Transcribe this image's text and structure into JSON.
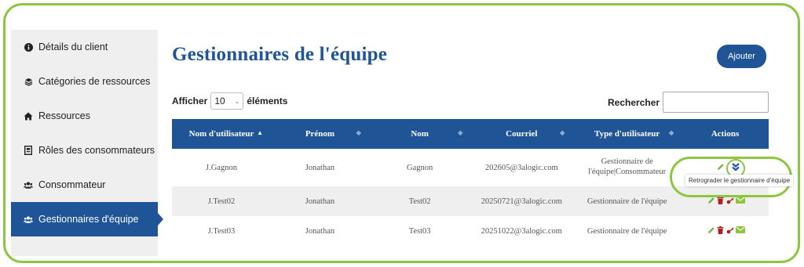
{
  "sidebar": {
    "items": [
      {
        "label": "Détails du client",
        "icon": "info-circle-icon"
      },
      {
        "label": "Catégories de ressources",
        "icon": "layers-icon"
      },
      {
        "label": "Ressources",
        "icon": "home-icon"
      },
      {
        "label": "Rôles des consommateurs",
        "icon": "id-card-icon"
      },
      {
        "label": "Consommateur",
        "icon": "users-icon"
      },
      {
        "label": "Gestionnaires d'équipe",
        "icon": "users-icon",
        "active": true
      }
    ]
  },
  "page": {
    "title": "Gestionnaires de l'équipe",
    "add_label": "Ajouter"
  },
  "controls": {
    "show_label": "Afficher",
    "page_size": "10",
    "entries_label": "éléments",
    "search_label": "Rechercher :"
  },
  "table": {
    "headers": [
      "Nom d'utilisateur",
      "Prénom",
      "Nom",
      "Courriel",
      "Type d'utilisateur",
      "Actions"
    ],
    "rows": [
      [
        "J.Gagnon",
        "Jonathan",
        "Gagnon",
        "202605@3alogic.com",
        "Gestionnaire de l'équipe|Consommateur"
      ],
      [
        "J.Test02",
        "Jonathan",
        "Test02",
        "20250721@3alogic.com",
        "Gestionnaire de l'équipe"
      ],
      [
        "J.Test03",
        "Jonathan",
        "Test03",
        "20251022@3alogic.com",
        "Gestionnaire de l'équipe"
      ]
    ]
  },
  "tooltip": {
    "text": "Retrograder le gestionnaire d'équipe"
  },
  "colors": {
    "primary": "#1f5596",
    "highlight": "#8cc63f",
    "edit": "#7cb342",
    "delete": "#b71c1c",
    "mail": "#8cc63f"
  }
}
